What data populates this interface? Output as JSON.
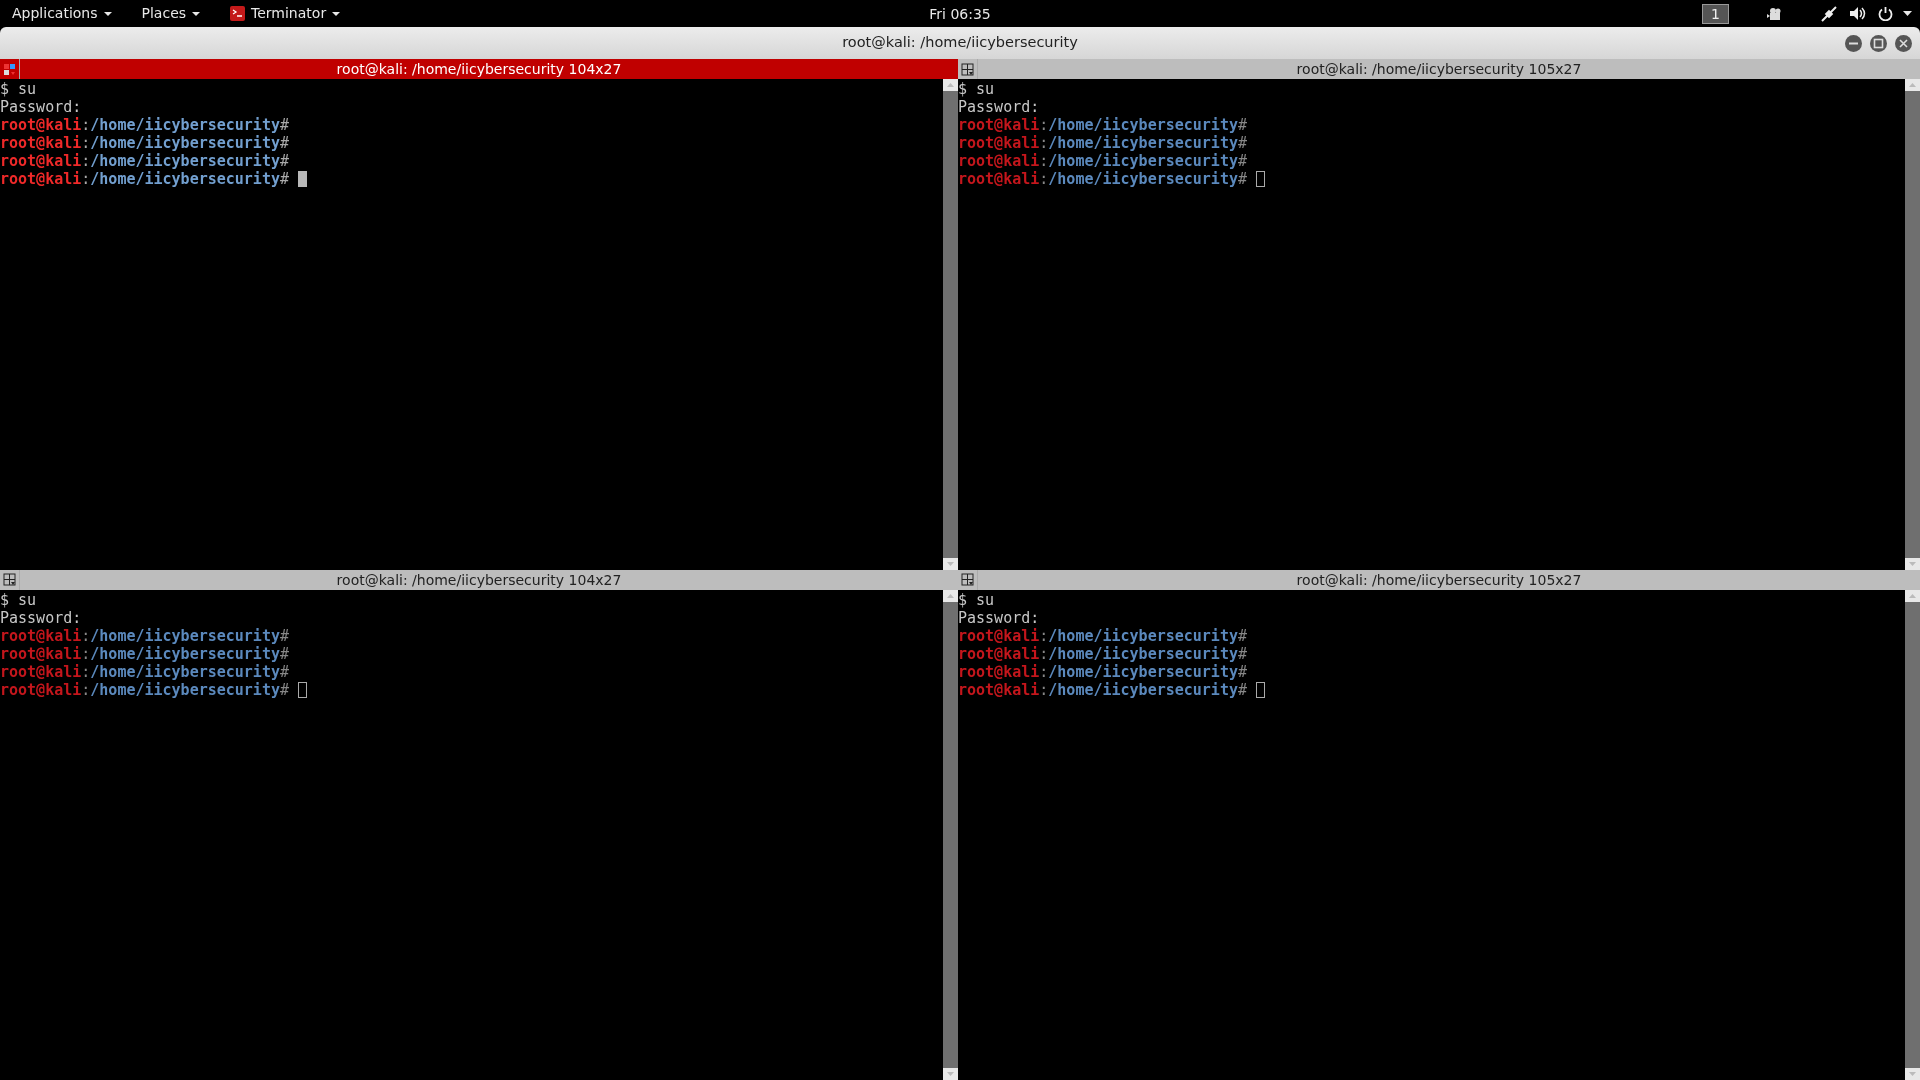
{
  "top_bar": {
    "menus": [
      {
        "label": "Applications",
        "kind": "menu"
      },
      {
        "label": "Places",
        "kind": "menu"
      },
      {
        "label": "Terminator",
        "kind": "app"
      }
    ],
    "clock": "Fri 06:35",
    "workspace": "1"
  },
  "window": {
    "title": "root@kali: /home/iicybersecurity"
  },
  "panes": [
    {
      "title": "root@kali: /home/iicybersecurity 104x27",
      "focused": true,
      "lines": [
        {
          "kind": "plain",
          "text": "$ su"
        },
        {
          "kind": "plain",
          "text": "Password:"
        },
        {
          "kind": "prompt",
          "user": "root@kali",
          "sep": ":",
          "path": "/home/iicybersecurity",
          "symbol": "#"
        },
        {
          "kind": "prompt",
          "user": "root@kali",
          "sep": ":",
          "path": "/home/iicybersecurity",
          "symbol": "#"
        },
        {
          "kind": "prompt",
          "user": "root@kali",
          "sep": ":",
          "path": "/home/iicybersecurity",
          "symbol": "#"
        },
        {
          "kind": "prompt",
          "user": "root@kali",
          "sep": ":",
          "path": "/home/iicybersecurity",
          "symbol": "#"
        }
      ]
    },
    {
      "title": "root@kali: /home/iicybersecurity 105x27",
      "focused": false,
      "lines": [
        {
          "kind": "plain",
          "text": "$ su"
        },
        {
          "kind": "plain",
          "text": "Password:"
        },
        {
          "kind": "prompt",
          "user": "root@kali",
          "sep": ":",
          "path": "/home/iicybersecurity",
          "symbol": "#"
        },
        {
          "kind": "prompt",
          "user": "root@kali",
          "sep": ":",
          "path": "/home/iicybersecurity",
          "symbol": "#"
        },
        {
          "kind": "prompt",
          "user": "root@kali",
          "sep": ":",
          "path": "/home/iicybersecurity",
          "symbol": "#"
        },
        {
          "kind": "prompt",
          "user": "root@kali",
          "sep": ":",
          "path": "/home/iicybersecurity",
          "symbol": "#"
        }
      ]
    },
    {
      "title": "root@kali: /home/iicybersecurity 104x27",
      "focused": false,
      "lines": [
        {
          "kind": "plain",
          "text": "$ su"
        },
        {
          "kind": "plain",
          "text": "Password:"
        },
        {
          "kind": "prompt",
          "user": "root@kali",
          "sep": ":",
          "path": "/home/iicybersecurity",
          "symbol": "#"
        },
        {
          "kind": "prompt",
          "user": "root@kali",
          "sep": ":",
          "path": "/home/iicybersecurity",
          "symbol": "#"
        },
        {
          "kind": "prompt",
          "user": "root@kali",
          "sep": ":",
          "path": "/home/iicybersecurity",
          "symbol": "#"
        },
        {
          "kind": "prompt",
          "user": "root@kali",
          "sep": ":",
          "path": "/home/iicybersecurity",
          "symbol": "#"
        }
      ]
    },
    {
      "title": "root@kali: /home/iicybersecurity 105x27",
      "focused": false,
      "lines": [
        {
          "kind": "plain",
          "text": "$ su"
        },
        {
          "kind": "plain",
          "text": "Password:"
        },
        {
          "kind": "prompt",
          "user": "root@kali",
          "sep": ":",
          "path": "/home/iicybersecurity",
          "symbol": "#"
        },
        {
          "kind": "prompt",
          "user": "root@kali",
          "sep": ":",
          "path": "/home/iicybersecurity",
          "symbol": "#"
        },
        {
          "kind": "prompt",
          "user": "root@kali",
          "sep": ":",
          "path": "/home/iicybersecurity",
          "symbol": "#"
        },
        {
          "kind": "prompt",
          "user": "root@kali",
          "sep": ":",
          "path": "/home/iicybersecurity",
          "symbol": "#"
        }
      ]
    }
  ]
}
